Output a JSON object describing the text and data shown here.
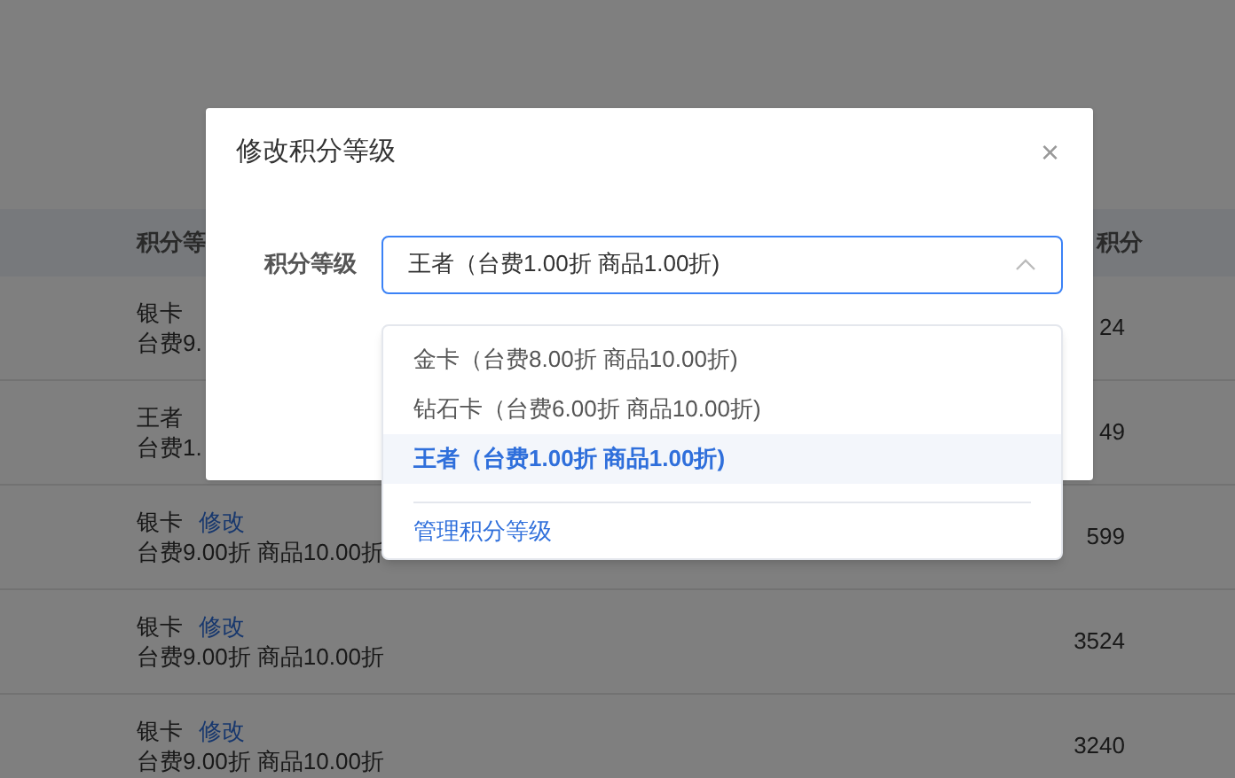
{
  "table": {
    "columns": [
      {
        "label": "积分等"
      },
      {
        "label": "积分"
      }
    ],
    "rows": [
      {
        "level": "银卡",
        "discount": "台费9.",
        "points": "24"
      },
      {
        "level": "王者",
        "discount": "台费1.",
        "points": "49"
      },
      {
        "level": "银卡",
        "action": "修改",
        "discount": "台费9.00折 商品10.00折",
        "points": "599"
      },
      {
        "level": "银卡",
        "action": "修改",
        "discount": "台费9.00折 商品10.00折",
        "points": "3524"
      },
      {
        "level": "银卡",
        "action": "修改",
        "discount": "台费9.00折 商品10.00折",
        "points": "3240"
      }
    ]
  },
  "dialog": {
    "title": "修改积分等级",
    "close": "×",
    "field_label": "积分等级",
    "select": {
      "value": "王者（台费1.00折 商品1.00折)",
      "expanded": true
    },
    "options": [
      {
        "label": "金卡（台费8.00折 商品10.00折)",
        "selected": false
      },
      {
        "label": "钻石卡（台费6.00折 商品10.00折)",
        "selected": false
      },
      {
        "label": "王者（台费1.00折 商品1.00折)",
        "selected": true
      }
    ],
    "manage_link": "管理积分等级"
  }
}
